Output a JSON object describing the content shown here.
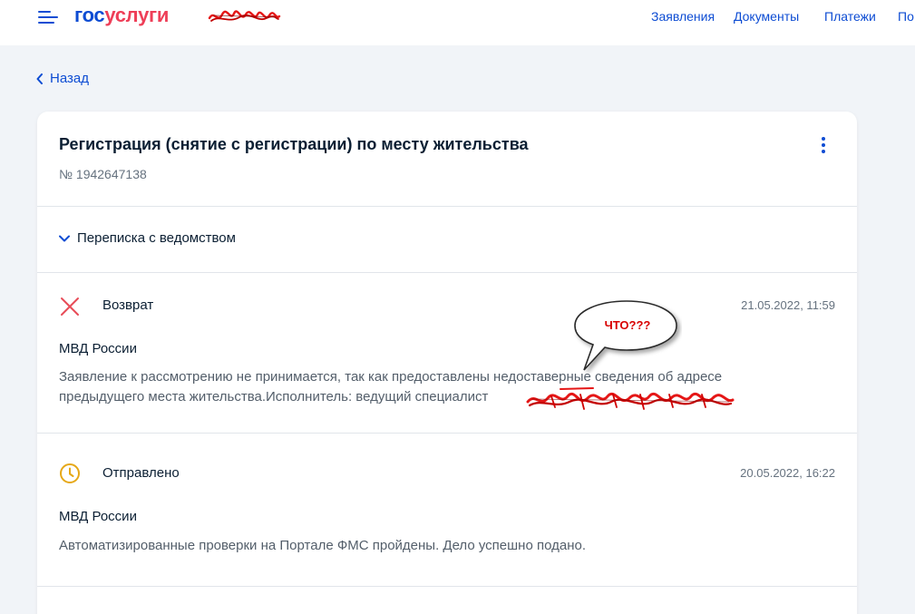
{
  "header": {
    "logo_part1": "гос",
    "logo_part2": "услуги",
    "nav": [
      "Заявления",
      "Документы",
      "Платежи",
      "По"
    ]
  },
  "back_label": "Назад",
  "application": {
    "title": "Регистрация (снятие с регистрации) по месту жительства",
    "number": "№ 1942647138",
    "correspondence_label": "Переписка с ведомством"
  },
  "events": [
    {
      "icon": "cross-icon",
      "status": "Возврат",
      "date": "21.05.2022, 11:59",
      "department": "МВД России",
      "text": "Заявление к рассмотрению не принимается, так как предоставлены недоставерные сведения об адресе предыдущего места жительства.Исполнитель: ведущий специалист"
    },
    {
      "icon": "clock-icon",
      "status": "Отправлено",
      "date": "20.05.2022, 16:22",
      "department": "МВД России",
      "text": "Автоматизированные проверки на Портале ФМС пройдены. Дело успешно подано."
    }
  ],
  "annotation": {
    "bubble_text": "ЧТО???"
  },
  "colors": {
    "accent": "#0d4cd3",
    "brand_red": "#ee3f58",
    "error": "#e84c57",
    "pending": "#e6a817",
    "background": "#f1f4f8"
  }
}
